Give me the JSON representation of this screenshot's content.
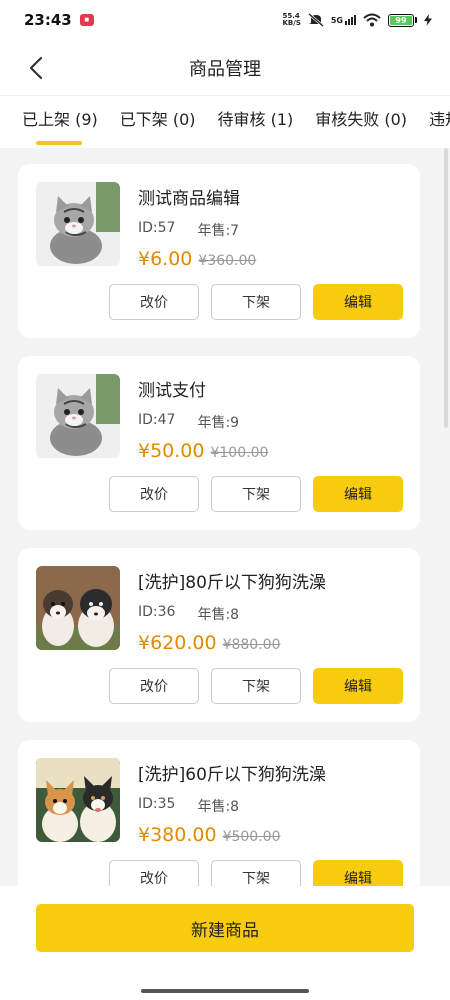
{
  "status_bar": {
    "time": "23:43",
    "network_speed_top": "55.4",
    "network_speed_bottom": "KB/S",
    "signal_label": "5G",
    "battery": "99"
  },
  "header": {
    "title": "商品管理"
  },
  "tabs": [
    {
      "label": "已上架 (9)",
      "active": true
    },
    {
      "label": "已下架 (0)"
    },
    {
      "label": "待审核 (1)"
    },
    {
      "label": "审核失败 (0)"
    },
    {
      "label": "违规"
    }
  ],
  "products": [
    {
      "name": "测试商品编辑",
      "id": "ID:57",
      "sales": "年售:7",
      "price": "¥6.00",
      "original_price": "¥360.00",
      "image": "kitten-icon",
      "btn_price": "改价",
      "btn_off": "下架",
      "btn_edit": "编辑"
    },
    {
      "name": "测试支付",
      "id": "ID:47",
      "sales": "年售:9",
      "price": "¥50.00",
      "original_price": "¥100.00",
      "image": "kitten-icon",
      "btn_price": "改价",
      "btn_off": "下架",
      "btn_edit": "编辑"
    },
    {
      "name": "[洗护]80斤以下狗狗洗澡",
      "id": "ID:36",
      "sales": "年售:8",
      "price": "¥620.00",
      "original_price": "¥880.00",
      "image": "husky-puppies-icon",
      "btn_price": "改价",
      "btn_off": "下架",
      "btn_edit": "编辑"
    },
    {
      "name": "[洗护]60斤以下狗狗洗澡",
      "id": "ID:35",
      "sales": "年售:8",
      "price": "¥380.00",
      "original_price": "¥500.00",
      "image": "corgi-icon",
      "btn_price": "改价",
      "btn_off": "下架",
      "btn_edit": "编辑"
    }
  ],
  "footer": {
    "new_button": "新建商品"
  },
  "colors": {
    "accent": "#f7cb0e",
    "price": "#e08a00"
  }
}
